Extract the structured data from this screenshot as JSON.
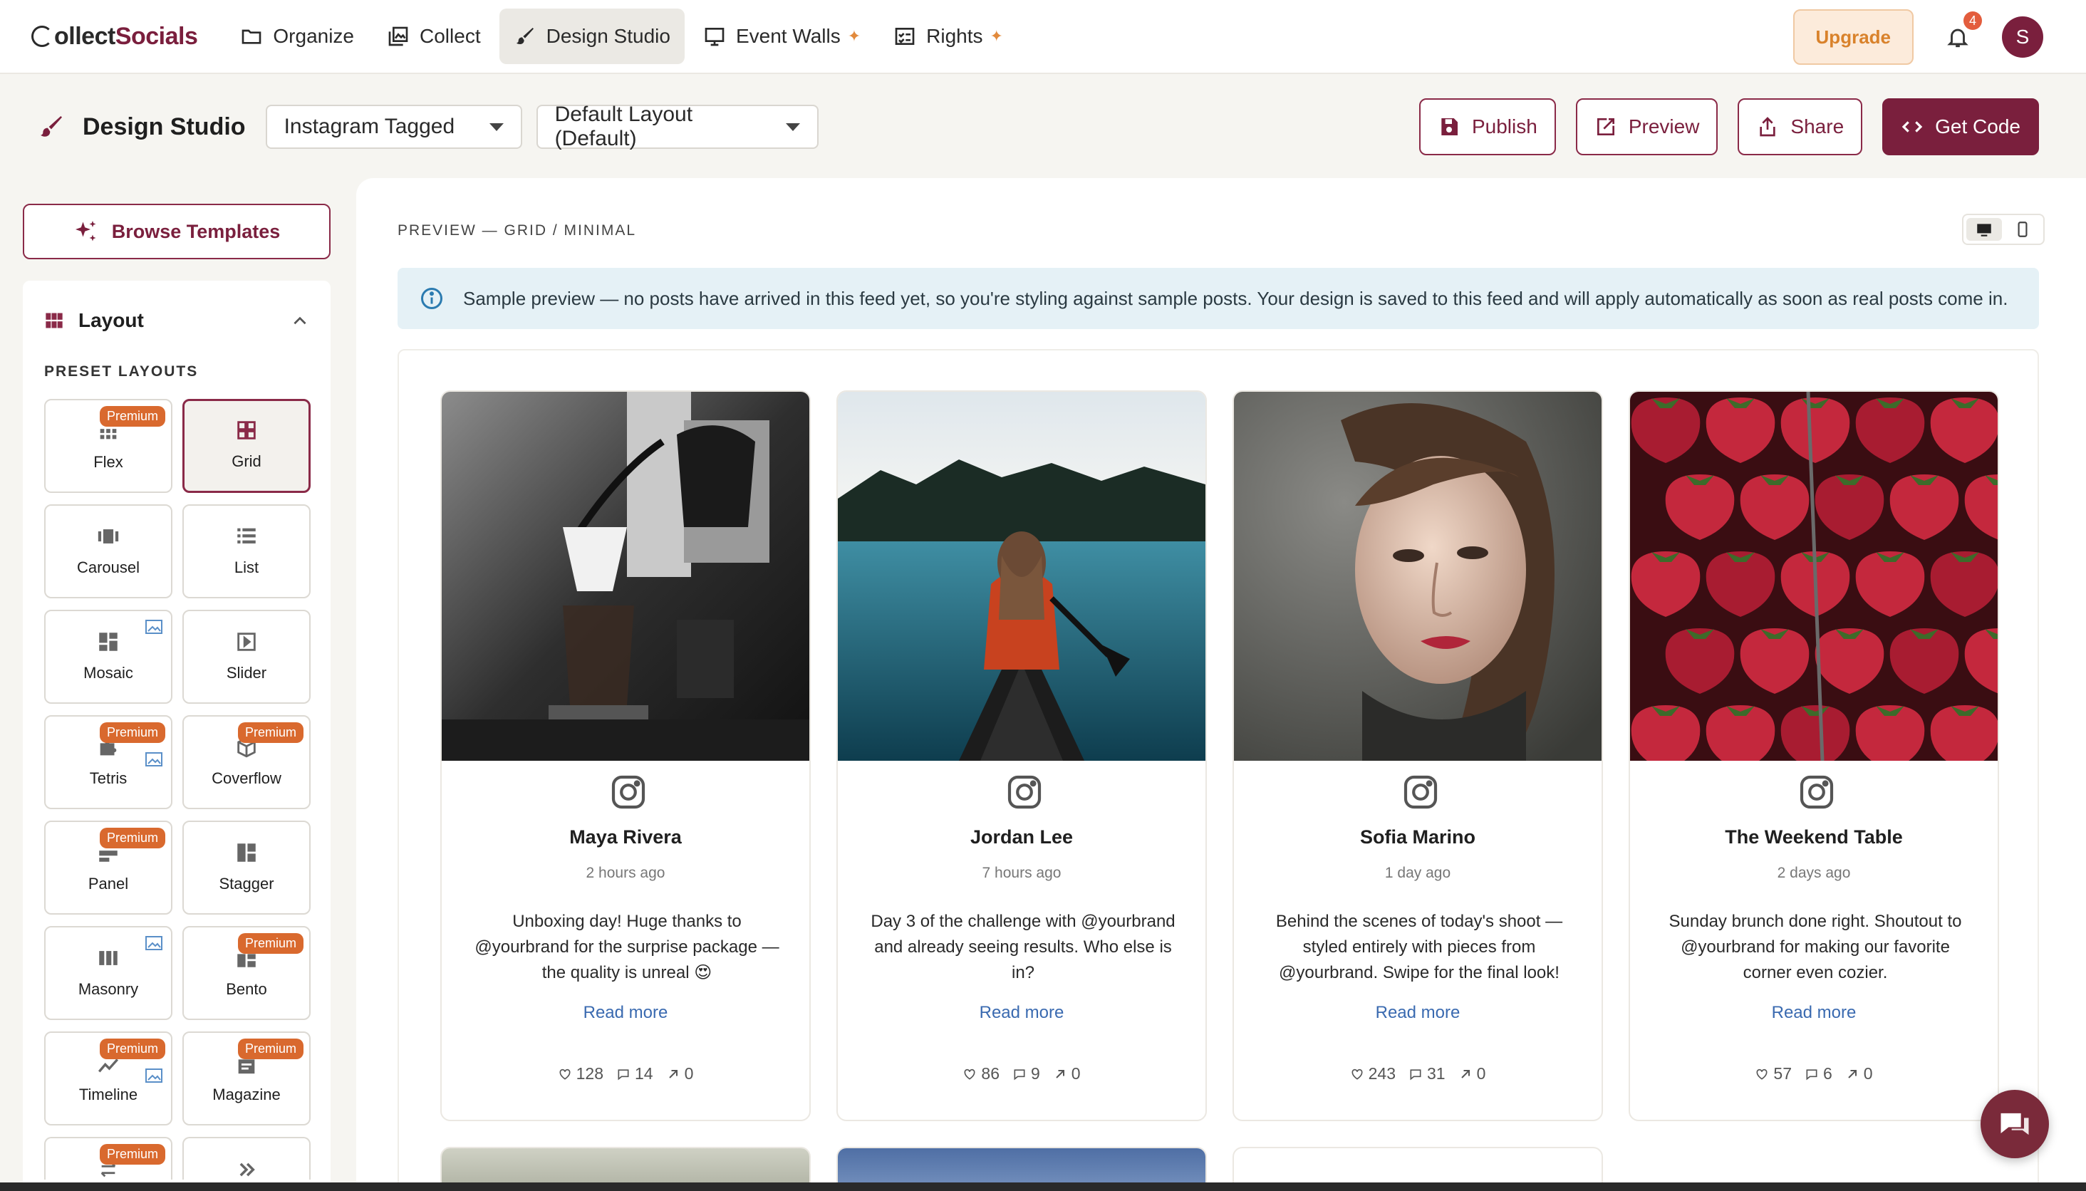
{
  "brand": {
    "name_prefix": "C",
    "name_mid": "ollect",
    "name_suffix": "Socials"
  },
  "nav": {
    "items": [
      {
        "label": "Organize",
        "icon": "folder-icon"
      },
      {
        "label": "Collect",
        "icon": "collect-icon"
      },
      {
        "label": "Design Studio",
        "icon": "brush-icon",
        "active": true
      },
      {
        "label": "Event Walls",
        "icon": "monitor-icon",
        "sparkle": true
      },
      {
        "label": "Rights",
        "icon": "rights-icon",
        "sparkle": true
      }
    ],
    "upgrade_label": "Upgrade",
    "notification_count": "4",
    "avatar_initial": "S"
  },
  "toolbar": {
    "title": "Design Studio",
    "feed_select": "Instagram Tagged",
    "layout_select": "Default Layout (Default)",
    "publish_label": "Publish",
    "preview_label": "Preview",
    "share_label": "Share",
    "get_code_label": "Get Code"
  },
  "sidebar": {
    "browse_label": "Browse Templates",
    "section_title": "Layout",
    "preset_heading": "PRESET LAYOUTS",
    "premium_label": "Premium",
    "tiles": [
      {
        "label": "Flex",
        "premium": true
      },
      {
        "label": "Grid",
        "selected": true
      },
      {
        "label": "Carousel"
      },
      {
        "label": "List"
      },
      {
        "label": "Mosaic",
        "image_indicator": true
      },
      {
        "label": "Slider"
      },
      {
        "label": "Tetris",
        "premium": true,
        "image_indicator": true
      },
      {
        "label": "Coverflow",
        "premium": true
      },
      {
        "label": "Panel",
        "premium": true
      },
      {
        "label": "Stagger"
      },
      {
        "label": "Masonry",
        "image_indicator": true
      },
      {
        "label": "Bento",
        "premium": true
      },
      {
        "label": "Timeline",
        "premium": true,
        "image_indicator": true
      },
      {
        "label": "Magazine",
        "premium": true
      }
    ]
  },
  "preview": {
    "label": "PREVIEW — GRID / MINIMAL",
    "notice": "Sample preview — no posts have arrived in this feed yet, so you're styling against sample posts. Your design is saved to this feed and will apply automatically as soon as real posts come in.",
    "read_more": "Read more",
    "posts": [
      {
        "name": "Maya Rivera",
        "time": "2 hours ago",
        "text": "Unboxing day! Huge thanks to @yourbrand for the surprise package — the quality is unreal 😍",
        "likes": "128",
        "comments": "14",
        "shares": "0",
        "photo": "coffee"
      },
      {
        "name": "Jordan Lee",
        "time": "7 hours ago",
        "text": "Day 3 of the challenge with @yourbrand and already seeing results. Who else is in?",
        "likes": "86",
        "comments": "9",
        "shares": "0",
        "photo": "lake"
      },
      {
        "name": "Sofia Marino",
        "time": "1 day ago",
        "text": "Behind the scenes of today's shoot — styled entirely with pieces from @yourbrand. Swipe for the final look!",
        "likes": "243",
        "comments": "31",
        "shares": "0",
        "photo": "portrait"
      },
      {
        "name": "The Weekend Table",
        "time": "2 days ago",
        "text": "Sunday brunch done right. Shoutout to @yourbrand for making our favorite corner even cozier.",
        "likes": "57",
        "comments": "6",
        "shares": "0",
        "photo": "strawberries"
      }
    ]
  },
  "colors": {
    "brand": "#7a1f3d",
    "accent": "#d9692e",
    "upgrade_bg": "#fcebdb",
    "info_bg": "#e5f1f6",
    "link": "#3a6ab0"
  }
}
